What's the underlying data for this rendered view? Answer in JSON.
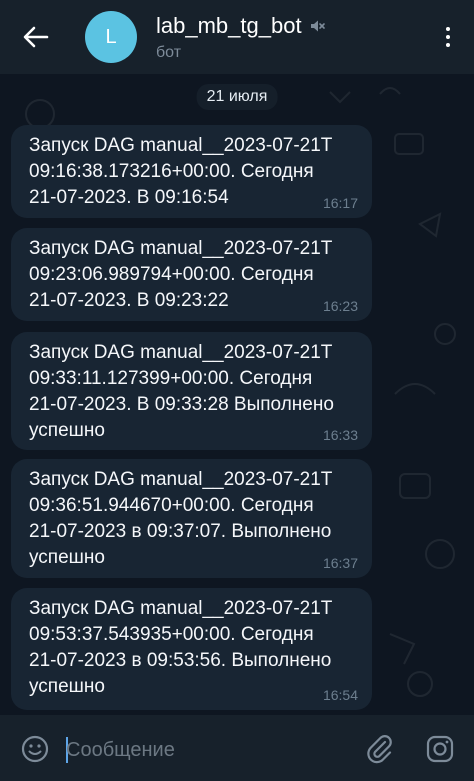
{
  "header": {
    "avatar_letter": "L",
    "title": "lab_mb_tg_bot",
    "subtitle": "бот"
  },
  "chat": {
    "date": "21 июля",
    "messages": [
      {
        "text": "Запуск DAG manual__2023-07-21T\n09:16:38.173216+00:00. Сегодня\n21-07-2023. В 09:16:54",
        "time": "16:17"
      },
      {
        "text": "Запуск DAG manual__2023-07-21T\n09:23:06.989794+00:00. Сегодня\n21-07-2023. В 09:23:22",
        "time": "16:23"
      },
      {
        "text": "Запуск DAG manual__2023-07-21T\n09:33:11.127399+00:00. Сегодня\n21-07-2023. В 09:33:28 Выполнено\nуспешно",
        "time": "16:33"
      },
      {
        "text": "Запуск DAG manual__2023-07-21T\n09:36:51.944670+00:00. Сегодня\n21-07-2023 в 09:37:07. Выполнено\nуспешно",
        "time": "16:37"
      },
      {
        "text": "Запуск DAG manual__2023-07-21T\n09:53:37.543935+00:00. Сегодня\n21-07-2023 в 09:53:56. Выполнено\nуспешно",
        "time": "16:54"
      }
    ]
  },
  "input": {
    "placeholder": "Сообщение"
  },
  "colors": {
    "background": "#0e1621",
    "header": "#17212b",
    "bubble": "#182533",
    "avatar": "#5bc3e2",
    "accent": "#5ea5e8"
  },
  "icons": [
    "back-arrow-icon",
    "mute-icon",
    "more-vert-icon",
    "emoji-icon",
    "attach-icon",
    "camera-icon"
  ]
}
